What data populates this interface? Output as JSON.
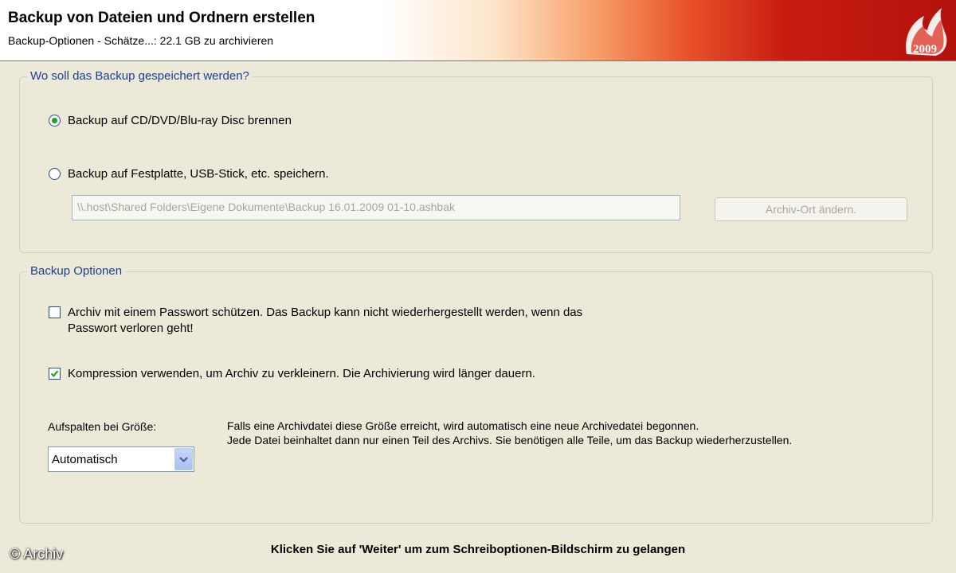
{
  "header": {
    "title": "Backup von Dateien und Ordnern erstellen",
    "subtitle": "Backup-Optionen - Schätze...: 22.1 GB zu archivieren",
    "logo_text": "2009"
  },
  "location_group": {
    "legend": "Wo soll das Backup gespeichert werden?",
    "options": [
      {
        "label": "Backup auf CD/DVD/Blu-ray Disc brennen",
        "selected": true
      },
      {
        "label": "Backup auf Festplatte, USB-Stick, etc. speichern.",
        "selected": false
      }
    ],
    "path_value": "\\\\.host\\Shared Folders\\Eigene Dokumente\\Backup 16.01.2009 01-10.ashbak",
    "change_location_button": "Archiv-Ort ändern."
  },
  "options_group": {
    "legend": "Backup Optionen",
    "password_checkbox": {
      "checked": false,
      "line1": "Archiv mit einem Passwort schützen. Das Backup kann nicht wiederhergestellt werden, wenn das",
      "line2": "Passwort verloren geht!"
    },
    "compression_checkbox": {
      "checked": true,
      "label": "Kompression verwenden, um Archiv zu verkleinern. Die Archivierung wird länger dauern."
    },
    "split_label": "Aufspalten bei Größe:",
    "split_value": "Automatisch",
    "split_info_line1": "Falls eine Archivdatei diese Größe erreicht, wird automatisch eine neue Archivedatei begonnen.",
    "split_info_line2": "Jede Datei beinhaltet dann nur einen Teil des Archivs. Sie benötigen alle Teile, um das Backup wiederherzustellen."
  },
  "footer": {
    "hint": "Klicken Sie auf 'Weiter' um zum Schreiboptionen-Bildschirm zu gelangen"
  },
  "watermark": "© Archiv"
}
